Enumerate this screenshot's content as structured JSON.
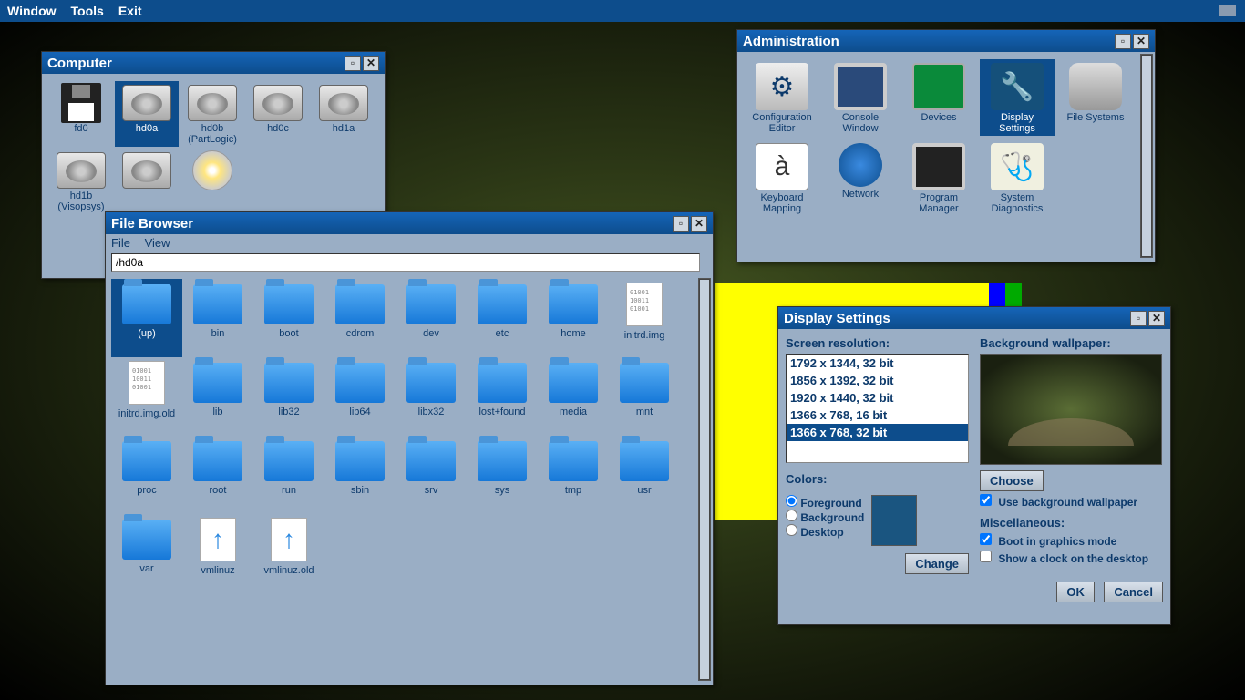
{
  "menubar": {
    "window": "Window",
    "tools": "Tools",
    "exit": "Exit"
  },
  "computer": {
    "title": "Computer",
    "drives": [
      {
        "name": "fd0",
        "type": "floppy"
      },
      {
        "name": "hd0a",
        "type": "hdd",
        "selected": true
      },
      {
        "name": "hd0b (PartLogic)",
        "type": "hdd"
      },
      {
        "name": "hd0c",
        "type": "hdd"
      },
      {
        "name": "hd1a",
        "type": "hdd"
      },
      {
        "name": "hd1b (Visopsys)",
        "type": "hdd"
      },
      {
        "name": "",
        "type": "hdd"
      },
      {
        "name": "",
        "type": "cd"
      }
    ]
  },
  "filebrowser": {
    "title": "File Browser",
    "menu": {
      "file": "File",
      "view": "View"
    },
    "path": "/hd0a",
    "items": [
      {
        "name": "(up)",
        "type": "folder",
        "selected": true
      },
      {
        "name": "bin",
        "type": "folder"
      },
      {
        "name": "boot",
        "type": "folder"
      },
      {
        "name": "cdrom",
        "type": "folder"
      },
      {
        "name": "dev",
        "type": "folder"
      },
      {
        "name": "etc",
        "type": "folder"
      },
      {
        "name": "home",
        "type": "folder"
      },
      {
        "name": "initrd.img",
        "type": "doc"
      },
      {
        "name": "initrd.img.old",
        "type": "doc"
      },
      {
        "name": "lib",
        "type": "folder"
      },
      {
        "name": "lib32",
        "type": "folder"
      },
      {
        "name": "lib64",
        "type": "folder"
      },
      {
        "name": "libx32",
        "type": "folder"
      },
      {
        "name": "lost+found",
        "type": "folder"
      },
      {
        "name": "media",
        "type": "folder"
      },
      {
        "name": "mnt",
        "type": "folder"
      },
      {
        "name": "proc",
        "type": "folder"
      },
      {
        "name": "root",
        "type": "folder"
      },
      {
        "name": "run",
        "type": "folder"
      },
      {
        "name": "sbin",
        "type": "folder"
      },
      {
        "name": "srv",
        "type": "folder"
      },
      {
        "name": "sys",
        "type": "folder"
      },
      {
        "name": "tmp",
        "type": "folder"
      },
      {
        "name": "usr",
        "type": "folder"
      },
      {
        "name": "var",
        "type": "folder"
      },
      {
        "name": "vmlinuz",
        "type": "arrow"
      },
      {
        "name": "vmlinuz.old",
        "type": "arrow"
      }
    ]
  },
  "admin": {
    "title": "Administration",
    "items": [
      {
        "name": "Configuration Editor",
        "icon": "gear"
      },
      {
        "name": "Console Window",
        "icon": "console"
      },
      {
        "name": "Devices",
        "icon": "devices"
      },
      {
        "name": "Display Settings",
        "icon": "display",
        "selected": true
      },
      {
        "name": "File Systems",
        "icon": "fs"
      },
      {
        "name": "Keyboard Mapping",
        "icon": "kbd"
      },
      {
        "name": "Network",
        "icon": "net"
      },
      {
        "name": "Program Manager",
        "icon": "prog"
      },
      {
        "name": "System Diagnostics",
        "icon": "diag"
      }
    ]
  },
  "display": {
    "title": "Display Settings",
    "screen_res_label": "Screen resolution:",
    "resolutions": [
      "1792 x 1344, 32 bit",
      "1856 x 1392, 32 bit",
      "1920 x 1440, 32 bit",
      "1366 x 768, 16 bit",
      "1366 x 768, 32 bit"
    ],
    "selected_res": 4,
    "colors_label": "Colors:",
    "radios": {
      "fg": "Foreground",
      "bg": "Background",
      "dt": "Desktop"
    },
    "change_btn": "Change",
    "wallpaper_label": "Background wallpaper:",
    "choose_btn": "Choose",
    "use_wallpaper": "Use background wallpaper",
    "misc_label": "Miscellaneous:",
    "boot_graphics": "Boot in graphics mode",
    "show_clock": "Show a clock on the desktop",
    "ok": "OK",
    "cancel": "Cancel"
  }
}
